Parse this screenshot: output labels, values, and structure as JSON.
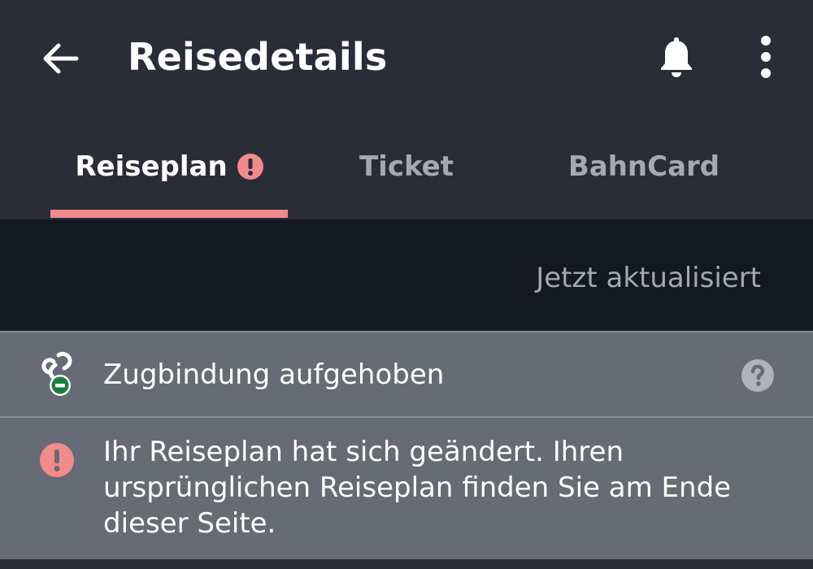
{
  "appbar": {
    "title": "Reisedetails",
    "back_icon": "arrow-left-icon",
    "bell_icon": "bell-icon",
    "more_icon": "more-vertical-icon"
  },
  "tabs": [
    {
      "label": "Reiseplan",
      "active": true,
      "alert": true
    },
    {
      "label": "Ticket",
      "active": false
    },
    {
      "label": "BahnCard",
      "active": false
    }
  ],
  "status": {
    "updated_text": "Jetzt aktualisiert"
  },
  "notices": {
    "binding": {
      "text": "Zugbindung aufgehoben",
      "icon": "unlinked-chain-icon",
      "help_icon": "help-icon"
    },
    "change": {
      "text": "Ihr Reiseplan hat sich geändert. Ihren ursprünglichen Reiseplan finden Sie am Ende dieser Seite.",
      "icon": "alert-icon"
    }
  },
  "colors": {
    "background": "#2a2d37",
    "accent": "#f28b8b",
    "band": "#141820",
    "row": "#676b75",
    "binding_badge": "#1a7f3c"
  }
}
